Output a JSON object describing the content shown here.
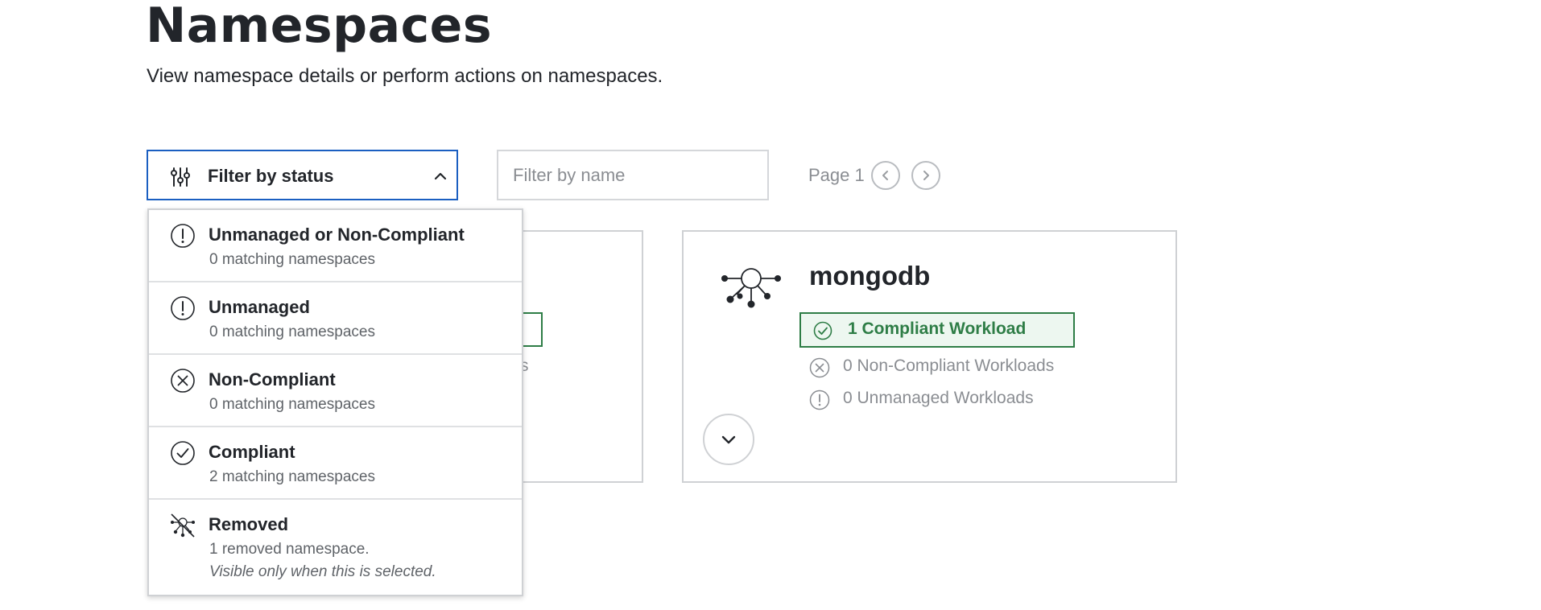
{
  "header": {
    "title": "Namespaces",
    "subtitle": "View namespace details or perform actions on namespaces."
  },
  "toolbar": {
    "status_filter_label": "Filter by status",
    "name_filter_placeholder": "Filter by name",
    "name_filter_value": "",
    "page_label": "Page 1",
    "icons": {
      "status_filter": "sliders-icon",
      "status_toggle": "chevron-up-icon",
      "prev": "chevron-left-icon",
      "next": "chevron-right-icon"
    }
  },
  "status_options": [
    {
      "title": "Unmanaged or Non-Compliant",
      "count": "0 matching namespaces",
      "icon": "exclamation-circle-icon"
    },
    {
      "title": "Unmanaged",
      "count": "0 matching namespaces",
      "icon": "exclamation-circle-icon"
    },
    {
      "title": "Non-Compliant",
      "count": "0 matching namespaces",
      "icon": "x-circle-icon"
    },
    {
      "title": "Compliant",
      "count": "2 matching namespaces",
      "icon": "check-circle-icon"
    },
    {
      "title": "Removed",
      "count": "1 removed namespace.",
      "note": "Visible only when this is selected.",
      "icon": "removed-namespace-icon"
    }
  ],
  "behind_card": {
    "stat_fragment": "s"
  },
  "namespace_card": {
    "name": "mongodb",
    "icon": "namespace-network-icon",
    "compliant": "1 Compliant Workload",
    "non_compliant": "0 Non-Compliant Workloads",
    "unmanaged": "0 Unmanaged Workloads",
    "expand_icon": "chevron-down-icon"
  },
  "colors": {
    "accent_blue": "#1b5fc1",
    "compliant_green": "#2e7d46",
    "muted_text": "#8a8d92",
    "border": "#cfd1d4"
  }
}
